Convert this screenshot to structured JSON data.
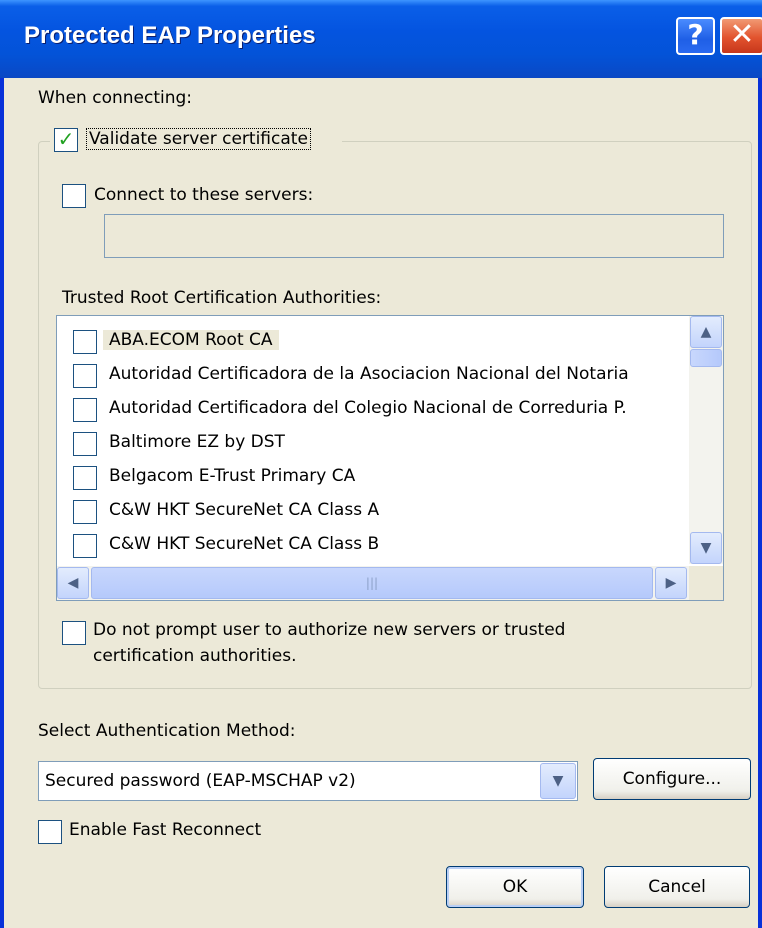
{
  "window": {
    "title": "Protected EAP Properties",
    "help_glyph": "?",
    "close_glyph": "✕"
  },
  "when_connecting_label": "When connecting:",
  "validate_cert": {
    "label": "Validate server certificate",
    "checked": true
  },
  "connect_servers": {
    "label": "Connect to these servers:",
    "checked": false,
    "value": ""
  },
  "trusted_root_label": "Trusted Root Certification Authorities:",
  "cert_list": [
    {
      "label": "ABA.ECOM Root CA",
      "checked": false
    },
    {
      "label": "Autoridad Certificadora de la Asociacion Nacional del Notaria",
      "checked": false
    },
    {
      "label": "Autoridad Certificadora del Colegio Nacional de Correduria P.",
      "checked": false
    },
    {
      "label": "Baltimore EZ by DST",
      "checked": false
    },
    {
      "label": "Belgacom E-Trust Primary CA",
      "checked": false
    },
    {
      "label": "C&W HKT SecureNet CA Class A",
      "checked": false
    },
    {
      "label": "C&W HKT SecureNet CA Class B",
      "checked": false
    }
  ],
  "do_not_prompt": {
    "label_line1": "Do not prompt user to authorize new servers or trusted",
    "label_line2": "certification authorities.",
    "checked": false
  },
  "auth_method_label": "Select Authentication Method:",
  "auth_method_value": "Secured password (EAP-MSCHAP v2)",
  "configure_button": "Configure...",
  "fast_reconnect": {
    "label": "Enable Fast Reconnect",
    "checked": false
  },
  "ok_button": "OK",
  "cancel_button": "Cancel",
  "icons": {
    "check": "check-icon",
    "scroll_up": "chevron-up-icon",
    "scroll_down": "chevron-down-icon",
    "scroll_left": "chevron-left-icon",
    "scroll_right": "chevron-right-icon",
    "grip": "grip-icon"
  }
}
